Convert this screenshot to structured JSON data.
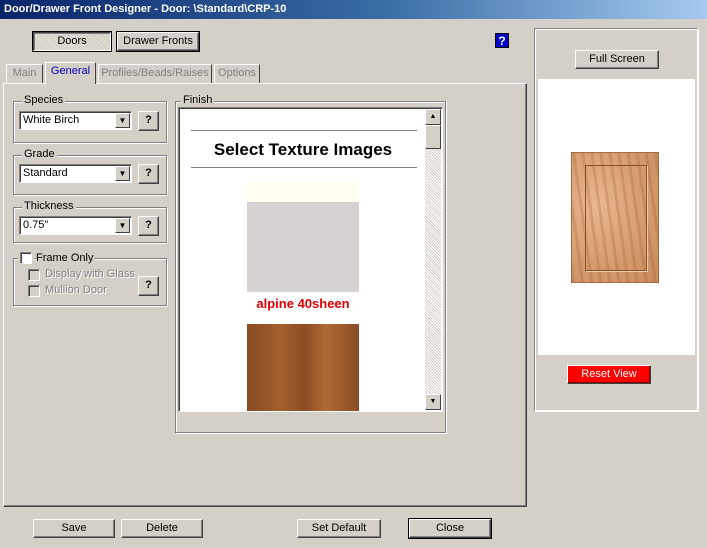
{
  "window": {
    "title": "Door/Drawer Front Designer - Door: \\Standard\\CRP-10"
  },
  "mode_buttons": {
    "doors": "Doors",
    "drawer_fronts": "Drawer Fronts"
  },
  "help_icon": "?",
  "tabs": [
    {
      "label": "Main",
      "active": false
    },
    {
      "label": "General",
      "active": true
    },
    {
      "label": "Profiles/Beads/Raises",
      "active": false
    },
    {
      "label": "Options",
      "active": false
    }
  ],
  "species": {
    "label": "Species",
    "value": "White Birch",
    "help": "?"
  },
  "grade": {
    "label": "Grade",
    "value": "Standard",
    "help": "?"
  },
  "thickness": {
    "label": "Thickness",
    "value": "0.75\"",
    "help": "?"
  },
  "frame_only": {
    "label": "Frame Only",
    "checked": false,
    "display_with_glass": "Display with Glass",
    "mullion_door": "Mullion Door",
    "help": "?"
  },
  "finish": {
    "label": "Finish",
    "heading": "Select Texture Images",
    "textures": [
      {
        "name": "alpine 40sheen",
        "color": "#d7d2d2",
        "name_color": "#e00000"
      },
      {
        "name": "",
        "color": "#8a4a22"
      }
    ]
  },
  "preview": {
    "full_screen": "Full Screen",
    "reset_view": "Reset View"
  },
  "footer": {
    "save": "Save",
    "delete": "Delete",
    "set_default": "Set Default",
    "close": "Close"
  },
  "colors": {
    "title_bar": "#0a246a",
    "active_tab_text": "#0000c0",
    "reset_button": "#ff0000"
  }
}
